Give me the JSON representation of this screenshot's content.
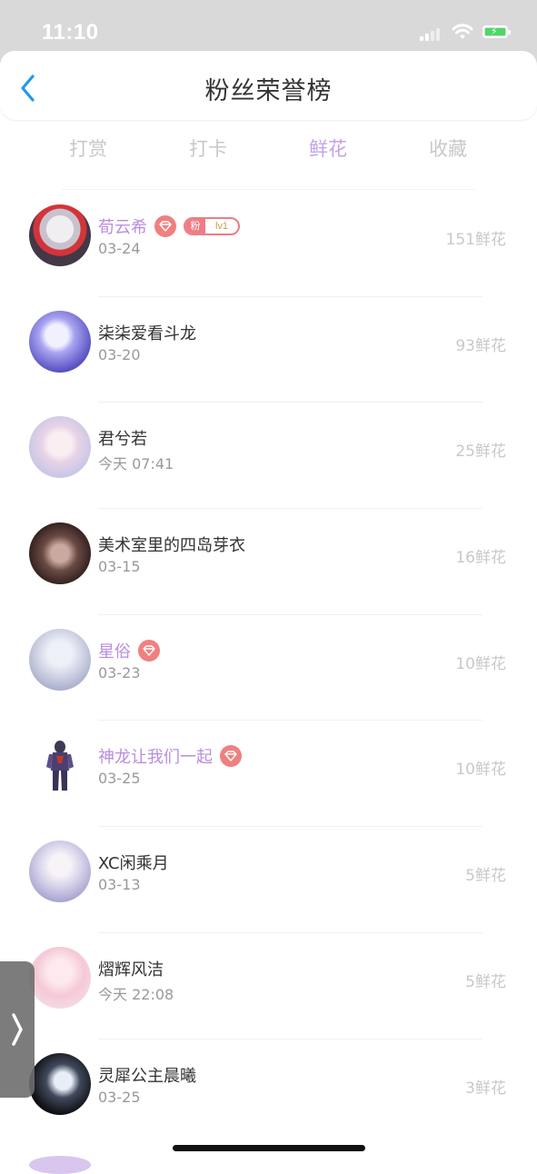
{
  "status_bar": {
    "time": "11:10"
  },
  "header": {
    "title": "粉丝荣誉榜",
    "back_icon": "chevron-left-icon"
  },
  "tabs": [
    {
      "label": "打赏",
      "active": false
    },
    {
      "label": "打卡",
      "active": false
    },
    {
      "label": "鲜花",
      "active": true
    },
    {
      "label": "收藏",
      "active": false
    }
  ],
  "colors": {
    "accent": "#c4a2e6",
    "vip_name": "#b98de0",
    "badge": "#ef7c85",
    "blue": "#1e9be8"
  },
  "badges": {
    "fan_left": "粉",
    "fan_right": "lv1"
  },
  "rows": [
    {
      "name": "荀云希",
      "date": "03-24",
      "amount": "151鲜花"
    },
    {
      "name": "柒柒爱看斗龙",
      "date": "03-20",
      "amount": "93鲜花"
    },
    {
      "name": "君兮若",
      "date": "今天 07:41",
      "amount": "25鲜花"
    },
    {
      "name": "美术室里的四岛芽衣",
      "date": "03-15",
      "amount": "16鲜花"
    },
    {
      "name": "星俗",
      "date": "03-23",
      "amount": "10鲜花"
    },
    {
      "name": "神龙让我们一起",
      "date": "03-25",
      "amount": "10鲜花"
    },
    {
      "name": "XC闲乘月",
      "date": "03-13",
      "amount": "5鲜花"
    },
    {
      "name": "熠辉风洁",
      "date": "今天 22:08",
      "amount": "5鲜花"
    },
    {
      "name": "灵犀公主晨曦",
      "date": "03-25",
      "amount": "3鲜花"
    }
  ]
}
